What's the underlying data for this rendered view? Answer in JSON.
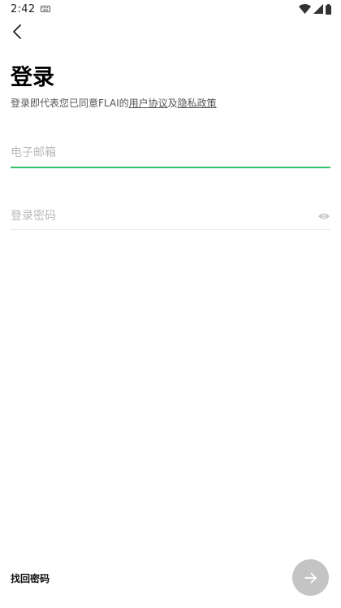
{
  "status_bar": {
    "time": "2:42",
    "keyboard_icon": "keyboard-icon",
    "wifi_icon": "wifi-icon",
    "signal_icon": "signal-icon",
    "battery_icon": "battery-icon"
  },
  "header": {
    "back_icon": "chevron-left-icon"
  },
  "login": {
    "title": "登录",
    "agreement_prefix": "登录即代表您已同意FLAI的",
    "user_agreement": "用户协议",
    "conjunction": "及",
    "privacy_policy": "隐私政策"
  },
  "email": {
    "placeholder": "电子邮箱",
    "value": ""
  },
  "password": {
    "placeholder": "登录密码",
    "value": "",
    "toggle_icon": "eye-icon"
  },
  "footer": {
    "forgot_password": "找回密码",
    "next_icon": "arrow-right-icon"
  },
  "colors": {
    "accent": "#34c26b",
    "button_disabled": "#c4c4c4",
    "placeholder": "#b9b9b9"
  }
}
